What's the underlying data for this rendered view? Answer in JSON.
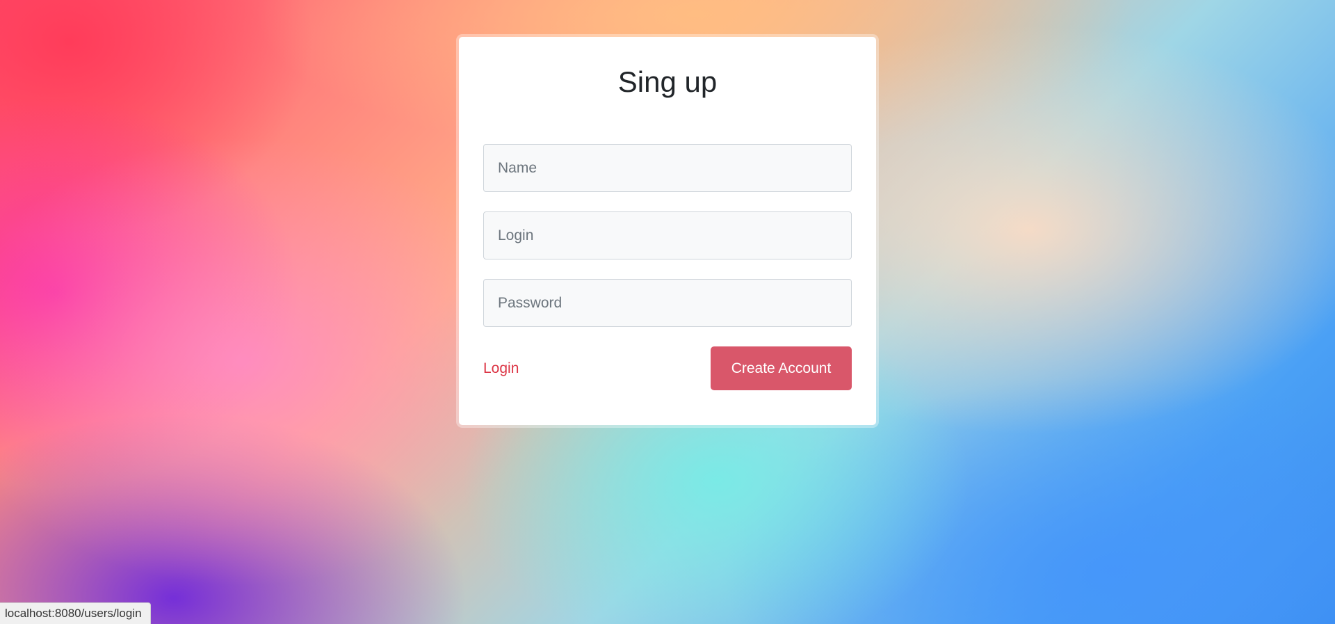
{
  "card": {
    "title": "Sing up",
    "fields": {
      "name_placeholder": "Name",
      "login_placeholder": "Login",
      "password_placeholder": "Password"
    },
    "login_link_label": "Login",
    "create_button_label": "Create Account"
  },
  "status_bar": {
    "url": "localhost:8080/users/login"
  },
  "colors": {
    "accent": "#dc3545",
    "button": "#d9576a"
  }
}
